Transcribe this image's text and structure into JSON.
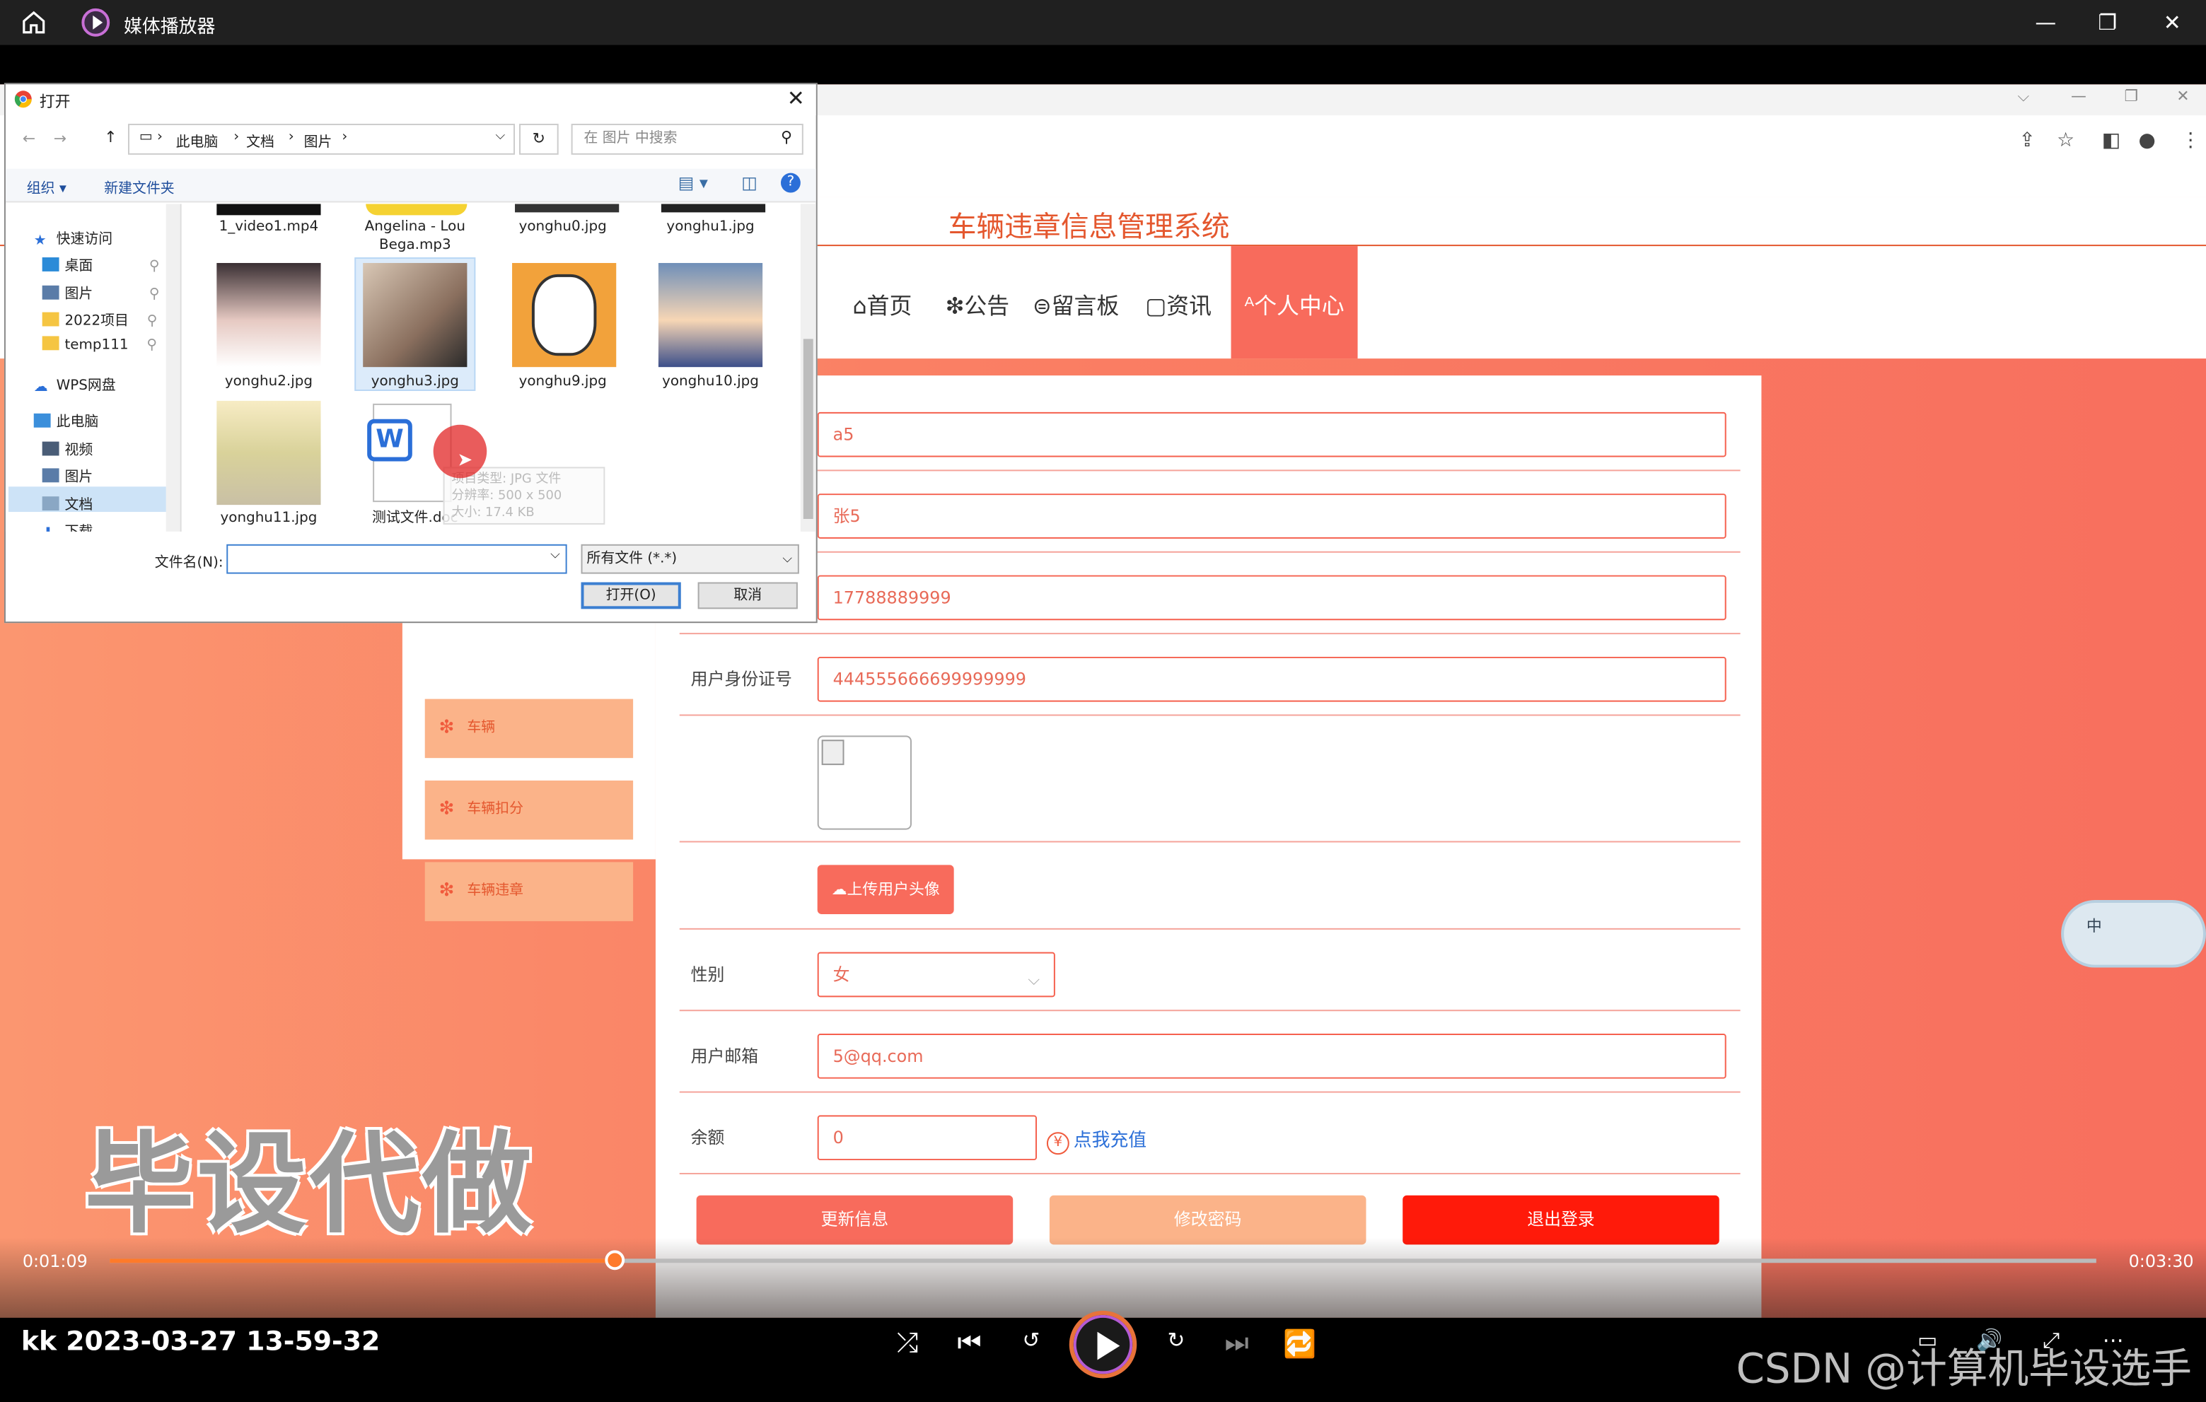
{
  "player": {
    "title": "媒体播放器",
    "current_time": "0:01:09",
    "total_time": "0:03:30",
    "progress_fraction": 0.254,
    "clip_title": "kk 2023-03-27 13-59-32"
  },
  "site": {
    "title": "车辆违章信息管理系统",
    "nav": [
      "⌂首页",
      "❇公告",
      "⊜留言板",
      "▢资讯",
      "ᴬ个人中心"
    ]
  },
  "sidebar": {
    "items": [
      "车辆",
      "车辆扣分",
      "车辆违章"
    ]
  },
  "form": {
    "username_value": "a5",
    "name_value": "张5",
    "phone_value": "17788889999",
    "id_label": "用户身份证号",
    "id_value": "444555666699999999",
    "upload_label": "上传用户头像",
    "gender_label": "性别",
    "gender_value": "女",
    "email_label": "用户邮箱",
    "email_value": "5@qq.com",
    "balance_label": "余额",
    "balance_value": "0",
    "recharge_label": "点我充值",
    "update_button": "更新信息",
    "password_button": "修改密码",
    "logout_button": "退出登录"
  },
  "dialog": {
    "title": "打开",
    "breadcrumb": [
      "此电脑",
      "文档",
      "图片"
    ],
    "search_placeholder": "在 图片 中搜索",
    "toolbar_organize": "组织 ▾",
    "toolbar_new_folder": "新建文件夹",
    "nav_tree": [
      "快速访问",
      "桌面",
      "图片",
      "2022项目",
      "temp111",
      "WPS网盘",
      "此电脑",
      "视频",
      "图片",
      "文档",
      "下载"
    ],
    "files": [
      {
        "name": "1_video1.mp4"
      },
      {
        "name": "Angelina - Lou Bega.mp3"
      },
      {
        "name": "yonghu0.jpg"
      },
      {
        "name": "yonghu1.jpg"
      },
      {
        "name": "yonghu2.jpg"
      },
      {
        "name": "yonghu3.jpg"
      },
      {
        "name": "yonghu9.jpg"
      },
      {
        "name": "yonghu10.jpg"
      },
      {
        "name": "yonghu11.jpg"
      },
      {
        "name": "测试文件.doc"
      }
    ],
    "tooltip_lines": [
      "项目类型: JPG 文件",
      "分辨率: 500 x 500",
      "大小: 17.4 KB"
    ],
    "filename_label": "文件名(N):",
    "filename_value": "",
    "filetype_value": "所有文件 (*.*)",
    "open_button": "打开(O)",
    "cancel_button": "取消"
  },
  "overlay": {
    "watermark_text": "毕设代做",
    "csdn_text": "CSDN @计算机毕设选手",
    "ime_text": "中"
  },
  "colors": {
    "accent": "#f86b5c",
    "title_red": "#e4572e",
    "logout_red": "#ff1a0a",
    "progress_orange": "#ff7a2a"
  }
}
